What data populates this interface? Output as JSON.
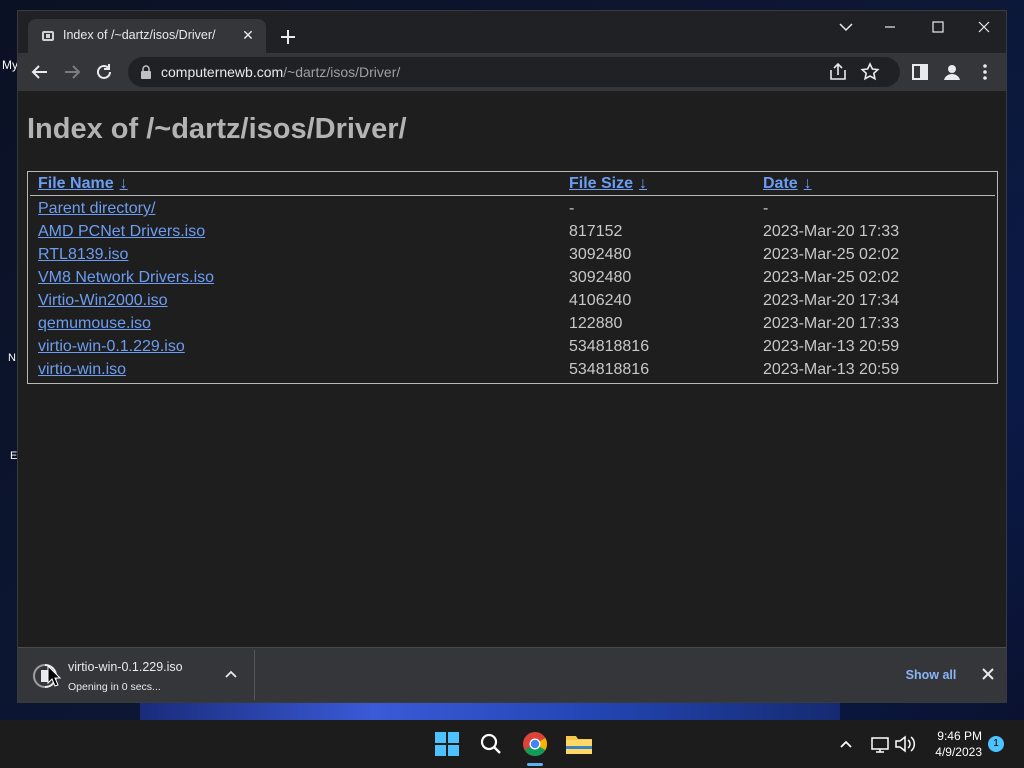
{
  "desktop": {
    "labels": [
      "My",
      "N",
      "E"
    ]
  },
  "browser": {
    "tab": {
      "title": "Index of /~dartz/isos/Driver/",
      "close_glyph": "✕"
    },
    "omnibox": {
      "host": "computernewb.com",
      "path": "/~dartz/isos/Driver/"
    }
  },
  "page": {
    "title": "Index of /~dartz/isos/Driver/",
    "columns": [
      {
        "label": "File Name",
        "sort_arrow": "↓"
      },
      {
        "label": "File Size",
        "sort_arrow": "↓"
      },
      {
        "label": "Date",
        "sort_arrow": "↓"
      }
    ],
    "rows": [
      {
        "name": "Parent directory/",
        "size": "-",
        "date": "-"
      },
      {
        "name": "AMD PCNet Drivers.iso",
        "size": "817152",
        "date": "2023-Mar-20 17:33"
      },
      {
        "name": "RTL8139.iso",
        "size": "3092480",
        "date": "2023-Mar-25 02:02"
      },
      {
        "name": "VM8 Network Drivers.iso",
        "size": "3092480",
        "date": "2023-Mar-25 02:02"
      },
      {
        "name": "Virtio-Win2000.iso",
        "size": "4106240",
        "date": "2023-Mar-20 17:34"
      },
      {
        "name": "qemumouse.iso",
        "size": "122880",
        "date": "2023-Mar-20 17:33"
      },
      {
        "name": "virtio-win-0.1.229.iso",
        "size": "534818816",
        "date": "2023-Mar-13 20:59"
      },
      {
        "name": "virtio-win.iso",
        "size": "534818816",
        "date": "2023-Mar-13 20:59"
      }
    ]
  },
  "download_shelf": {
    "file_name": "virtio-win-0.1.229.iso",
    "status": "Opening in 0 secs...",
    "show_all_label": "Show all"
  },
  "taskbar": {
    "time": "9:46 PM",
    "date": "4/9/2023",
    "notification_count": "1"
  },
  "colors": {
    "link": "#6d9df2",
    "page_bg": "#1e1e1e",
    "accent": "#8ab4f8"
  },
  "icons": [
    "tab-favicon-icon",
    "close-icon",
    "plus-icon",
    "chevron-down-icon",
    "minimize-icon",
    "maximize-icon",
    "back-icon",
    "forward-icon",
    "reload-icon",
    "lock-icon",
    "share-icon",
    "star-icon",
    "side-panel-icon",
    "profile-icon",
    "kebab-menu-icon",
    "download-progress-icon",
    "chevron-up-icon",
    "windows-start-icon",
    "search-icon",
    "chrome-icon",
    "file-explorer-icon",
    "tray-chevron-icon",
    "network-icon",
    "volume-icon"
  ]
}
